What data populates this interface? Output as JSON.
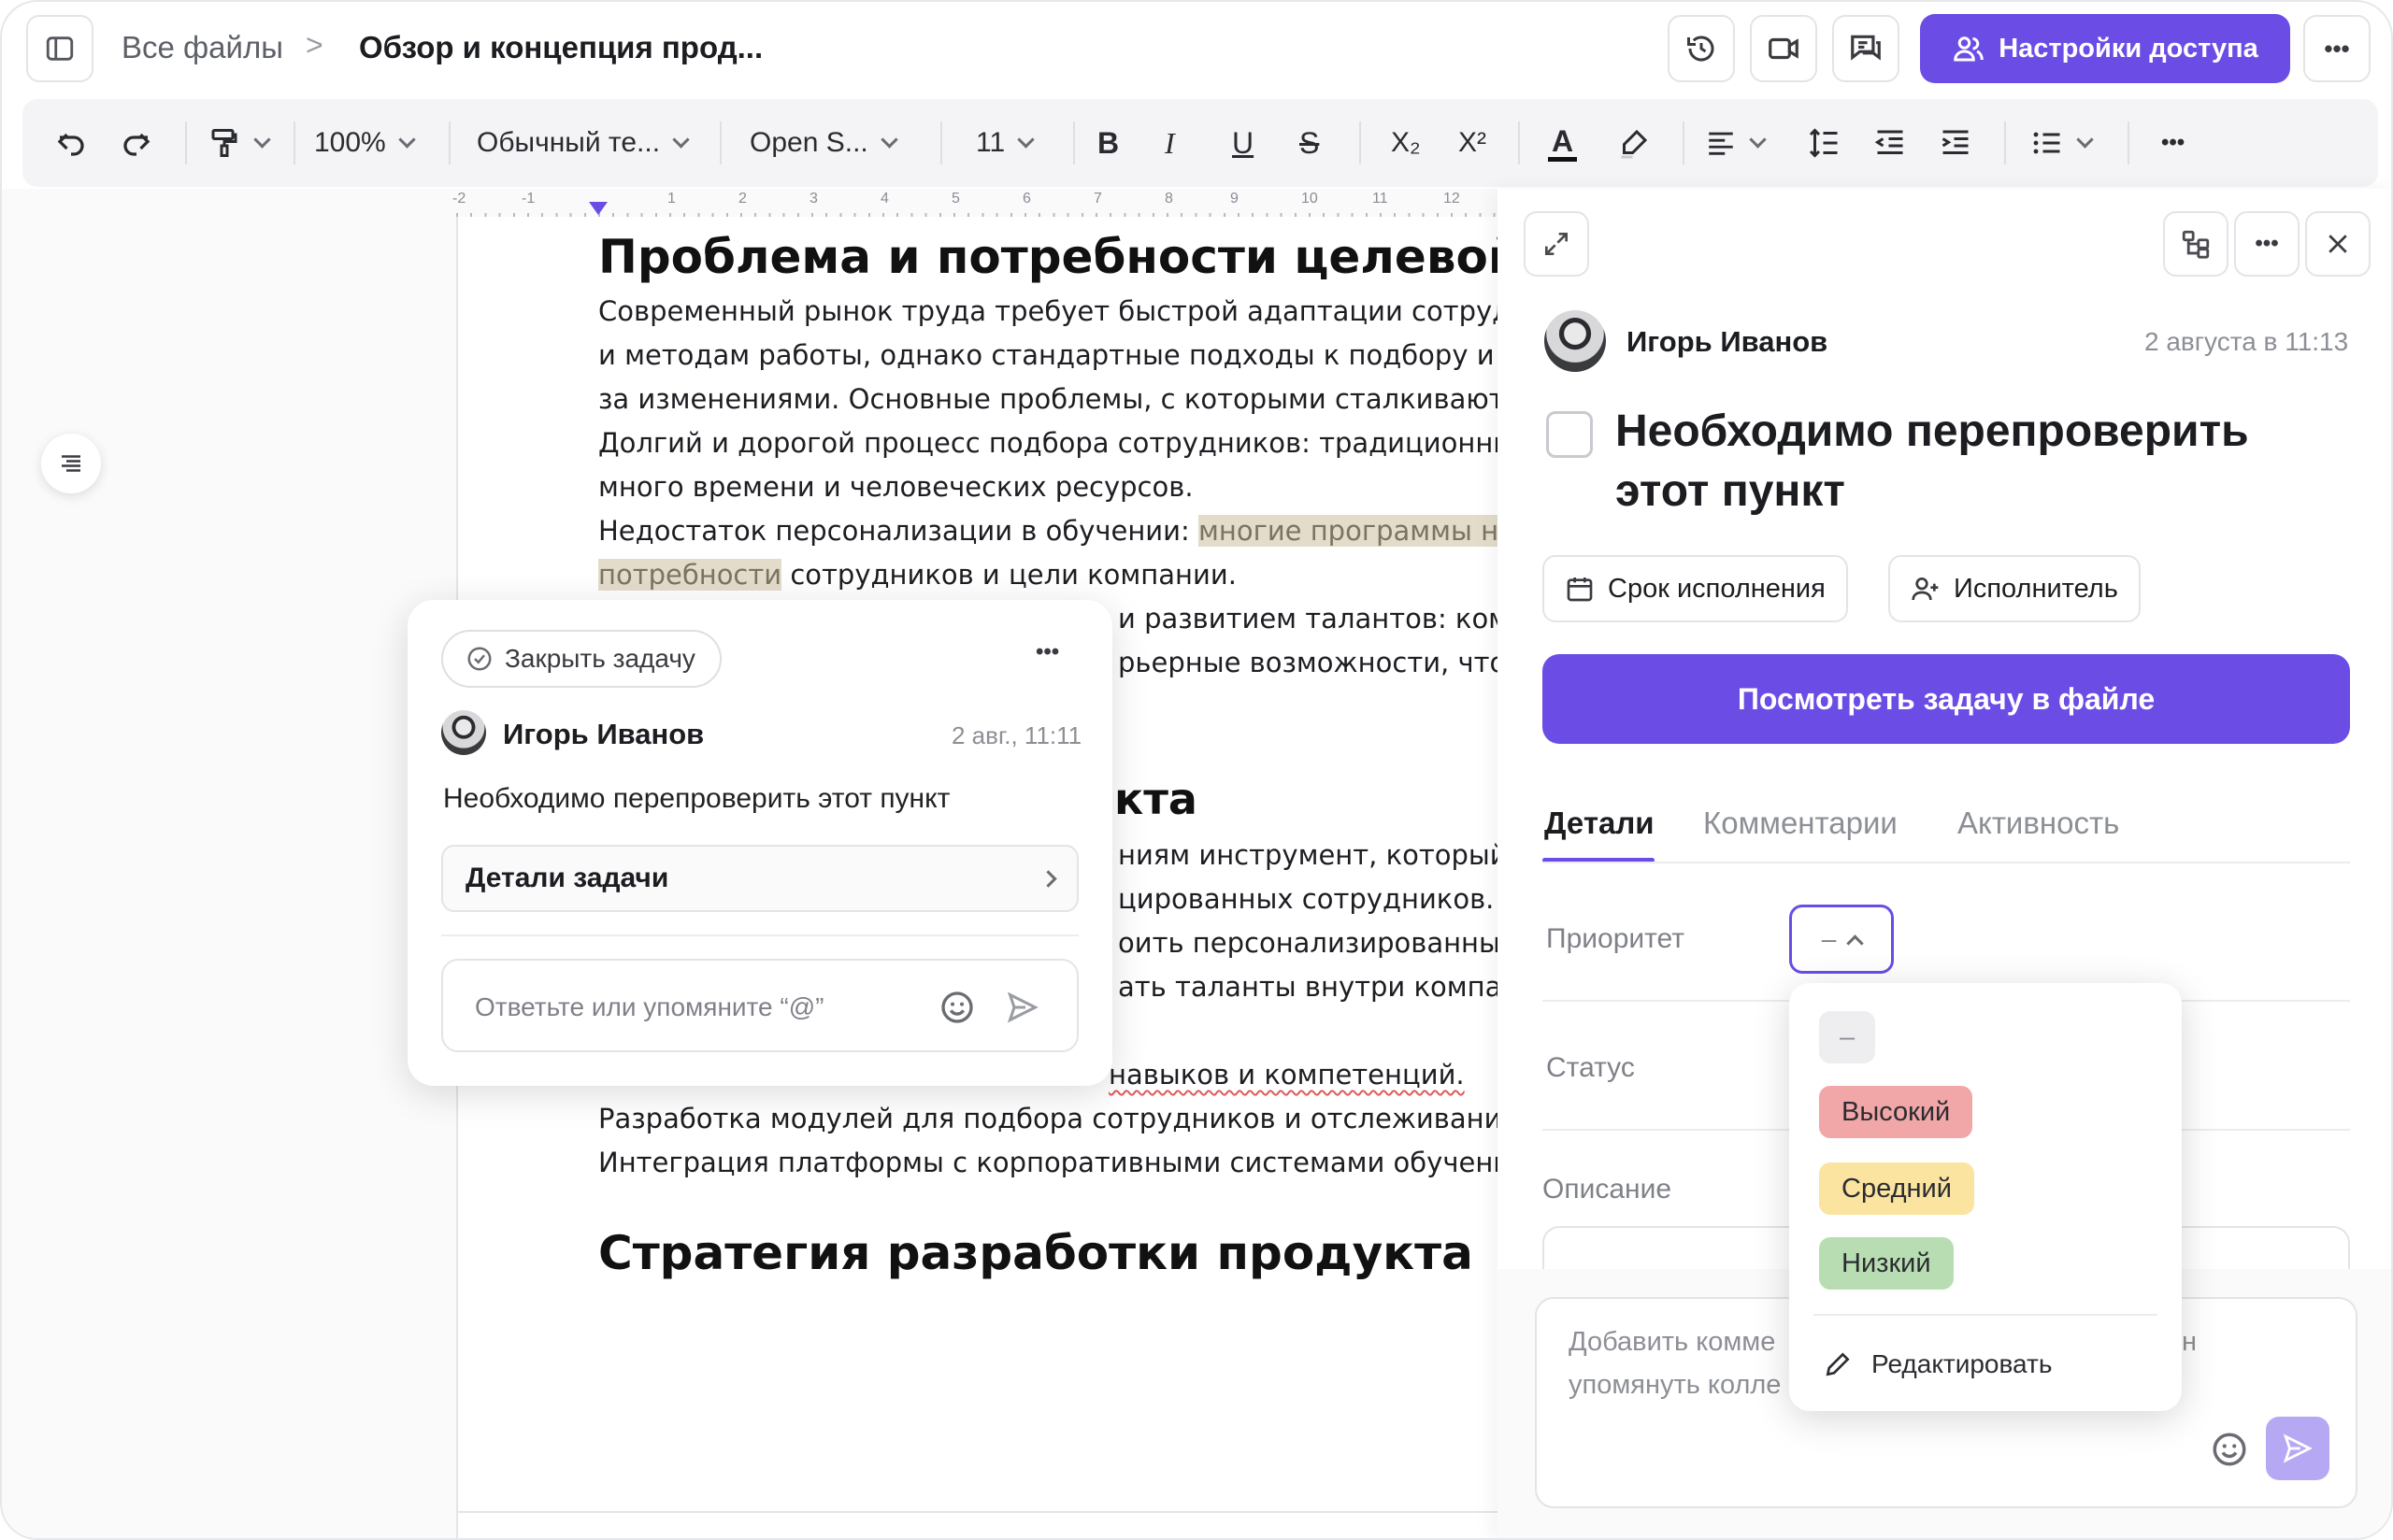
{
  "header": {
    "breadcrumb_all": "Все файлы",
    "breadcrumb_sep": ">",
    "doc_title": "Обзор и концепция прод...",
    "share_label": "Настройки доступа",
    "more": "•••"
  },
  "toolbar": {
    "zoom": "100%",
    "style": "Обычный те...",
    "font": "Open S...",
    "size": "11",
    "bold": "B",
    "italic": "I",
    "underline": "U",
    "strike": "S",
    "sub": "X₂",
    "sup": "X²",
    "textcolor": "A",
    "more": "•••"
  },
  "ruler": [
    "-2",
    "-1",
    "1",
    "2",
    "3",
    "4",
    "5",
    "6",
    "7",
    "8",
    "9",
    "10",
    "11",
    "12"
  ],
  "document": {
    "heading1": "Проблема и потребности целевой ауд",
    "p1": "Современный рынок труда требует быстрой адаптации сотрудника",
    "p2": "и методам работы, однако стандартные подходы к подбору и обуче",
    "p3": "за изменениями. Основные проблемы, с которыми сталкиваются к",
    "p4": "Долгий и дорогой процесс подбора сотрудников: традиционные ме",
    "p5": "много времени и человеческих ресурсов.",
    "p6_a": "Недостаток персонализации в обучении: ",
    "p6_hl": "многие программы не уч",
    "p7_hl": "потребности",
    "p7_b": " сотрудников и цели компании.",
    "p8": "и развитием талантов: компа",
    "p9": "рьерные возможности, что пр",
    "heading2_tail": "кта",
    "p10": "ниям инструмент, который п",
    "p11": "цированных сотрудников.",
    "p12": "оить персонализированные п",
    "p13": "ать таланты внутри компани",
    "p14": "навыков и компетенций.",
    "p15": "Разработка модулей для подбора сотрудников и отслеживания их р",
    "p16": "Интеграция платформы с корпоративными системами обучения.",
    "heading3": "Стратегия разработки продукта"
  },
  "popup": {
    "close_task": "Закрыть задачу",
    "author": "Игорь Иванов",
    "time": "2 авг., 11:11",
    "text": "Необходимо перепроверить этот пункт",
    "details": "Детали задачи",
    "reply_placeholder": "Ответьте или упомяните “@”",
    "more": "•••"
  },
  "panel": {
    "author": "Игорь Иванов",
    "date": "2 августа в 11:13",
    "title_line1": "Необходимо перепроверить",
    "title_line2": "этот пункт",
    "due_label": "Срок исполнения",
    "assignee_label": "Исполнитель",
    "view_button": "Посмотреть задачу в файле",
    "tabs": [
      "Детали",
      "Комментарии",
      "Активность"
    ],
    "priority_label": "Приоритет",
    "priority_value": "–",
    "status_label": "Статус",
    "description_label": "Описание",
    "comment_placeholder_1": "Добавить комме",
    "comment_placeholder_2": "упомянуть колле",
    "comment_tail": "н",
    "more": "•••"
  },
  "priority_dropdown": {
    "none": "–",
    "options": [
      {
        "label": "Высокий",
        "color": "#f1a6a8"
      },
      {
        "label": "Средний",
        "color": "#fbe3a0"
      },
      {
        "label": "Низкий",
        "color": "#b9ddb2"
      }
    ],
    "edit": "Редактировать"
  },
  "colors": {
    "accent": "#6b4de6",
    "highlight": "#e4dccb"
  }
}
